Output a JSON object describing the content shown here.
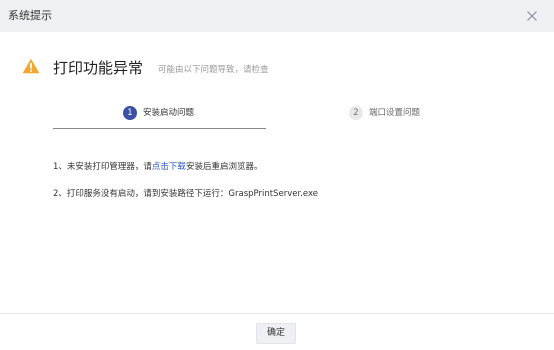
{
  "window": {
    "title": "系统提示",
    "close_icon": "close-icon"
  },
  "alert": {
    "icon": "warning-icon",
    "icon_color": "#f0a82f",
    "heading": "打印功能异常",
    "subheading": "可能由以下问题导致，请检查"
  },
  "steps": [
    {
      "number": "1",
      "label": "安装启动问题",
      "active": true
    },
    {
      "number": "2",
      "label": "端口设置问题",
      "active": false
    }
  ],
  "instructions": {
    "line1": {
      "prefix": "1、未安装打印管理器，请",
      "link": "点击下载",
      "suffix": "安装后重启浏览器。"
    },
    "line2": "2、打印服务没有启动，请到安装路径下运行：GraspPrintServer.exe"
  },
  "footer": {
    "confirm_label": "确定"
  },
  "colors": {
    "accent": "#3b4fa5",
    "link": "#2d54c7",
    "titlebar": "#eef0f3"
  }
}
